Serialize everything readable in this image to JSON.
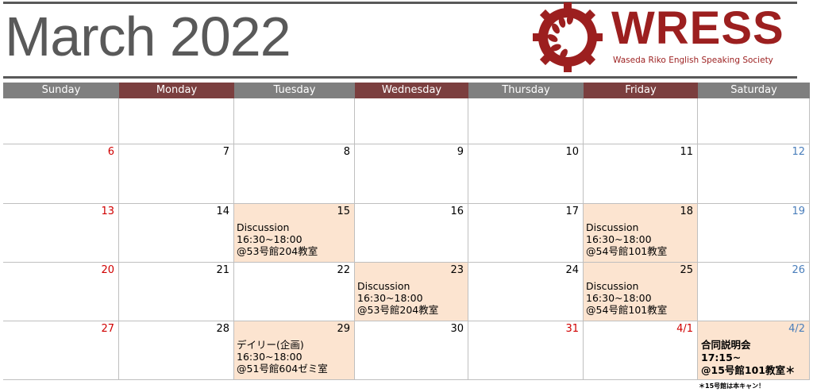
{
  "title": "March 2022",
  "logo": {
    "name": "WRESS",
    "subtitle": "Waseda Riko English Speaking Society",
    "icon": "gear-leaf-icon",
    "color": "#9c1f1f"
  },
  "colors": {
    "header_gray": "#7f7f7f",
    "header_maroon": "#7b3f3f",
    "highlight": "#fce4d0",
    "sunday_red": "#d00000",
    "saturday_blue": "#4a7ebb",
    "weekday_black": "#000000"
  },
  "weekdays": [
    {
      "label": "Sunday",
      "tone": "gray"
    },
    {
      "label": "Monday",
      "tone": "maroon"
    },
    {
      "label": "Tuesday",
      "tone": "gray"
    },
    {
      "label": "Wednesday",
      "tone": "maroon"
    },
    {
      "label": "Thursday",
      "tone": "gray"
    },
    {
      "label": "Friday",
      "tone": "maroon"
    },
    {
      "label": "Saturday",
      "tone": "gray"
    }
  ],
  "weeks": [
    [
      {
        "day": "",
        "color": "black",
        "highlight": false,
        "event": ""
      },
      {
        "day": "",
        "color": "black",
        "highlight": false,
        "event": ""
      },
      {
        "day": "",
        "color": "black",
        "highlight": false,
        "event": ""
      },
      {
        "day": "",
        "color": "black",
        "highlight": false,
        "event": ""
      },
      {
        "day": "",
        "color": "black",
        "highlight": false,
        "event": ""
      },
      {
        "day": "",
        "color": "black",
        "highlight": false,
        "event": ""
      },
      {
        "day": "",
        "color": "black",
        "highlight": false,
        "event": ""
      }
    ],
    [
      {
        "day": "6",
        "color": "red",
        "highlight": false,
        "event": ""
      },
      {
        "day": "7",
        "color": "black",
        "highlight": false,
        "event": ""
      },
      {
        "day": "8",
        "color": "black",
        "highlight": false,
        "event": ""
      },
      {
        "day": "9",
        "color": "black",
        "highlight": false,
        "event": ""
      },
      {
        "day": "10",
        "color": "black",
        "highlight": false,
        "event": ""
      },
      {
        "day": "11",
        "color": "black",
        "highlight": false,
        "event": ""
      },
      {
        "day": "12",
        "color": "blue",
        "highlight": false,
        "event": ""
      }
    ],
    [
      {
        "day": "13",
        "color": "red",
        "highlight": false,
        "event": ""
      },
      {
        "day": "14",
        "color": "black",
        "highlight": false,
        "event": ""
      },
      {
        "day": "15",
        "color": "black",
        "highlight": true,
        "event": "Discussion\n16:30~18:00\n@53号館204教室"
      },
      {
        "day": "16",
        "color": "black",
        "highlight": false,
        "event": ""
      },
      {
        "day": "17",
        "color": "black",
        "highlight": false,
        "event": ""
      },
      {
        "day": "18",
        "color": "black",
        "highlight": true,
        "event": "Discussion\n16:30~18:00\n@54号館101教室"
      },
      {
        "day": "19",
        "color": "blue",
        "highlight": false,
        "event": ""
      }
    ],
    [
      {
        "day": "20",
        "color": "red",
        "highlight": false,
        "event": ""
      },
      {
        "day": "21",
        "color": "black",
        "highlight": false,
        "event": ""
      },
      {
        "day": "22",
        "color": "black",
        "highlight": false,
        "event": ""
      },
      {
        "day": "23",
        "color": "black",
        "highlight": true,
        "event": "Discussion\n16:30~18:00\n@53号館204教室"
      },
      {
        "day": "24",
        "color": "black",
        "highlight": false,
        "event": ""
      },
      {
        "day": "25",
        "color": "black",
        "highlight": true,
        "event": "Discussion\n16:30~18:00\n@54号館101教室"
      },
      {
        "day": "26",
        "color": "blue",
        "highlight": false,
        "event": ""
      }
    ],
    [
      {
        "day": "27",
        "color": "red",
        "highlight": false,
        "event": ""
      },
      {
        "day": "28",
        "color": "black",
        "highlight": false,
        "event": ""
      },
      {
        "day": "29",
        "color": "black",
        "highlight": true,
        "event": "デイリー(企画)\n16:30~18:00\n@51号館604ゼミ室"
      },
      {
        "day": "30",
        "color": "black",
        "highlight": false,
        "event": ""
      },
      {
        "day": "31",
        "color": "red",
        "highlight": false,
        "event": ""
      },
      {
        "day": "4/1",
        "color": "red",
        "highlight": false,
        "event": ""
      },
      {
        "day": "4/2",
        "color": "blue",
        "highlight": true,
        "event": "合同説明会\n17:15~\n@15号館101教室＊",
        "bold": true
      }
    ]
  ],
  "note": "＊15号館は本キャン！"
}
